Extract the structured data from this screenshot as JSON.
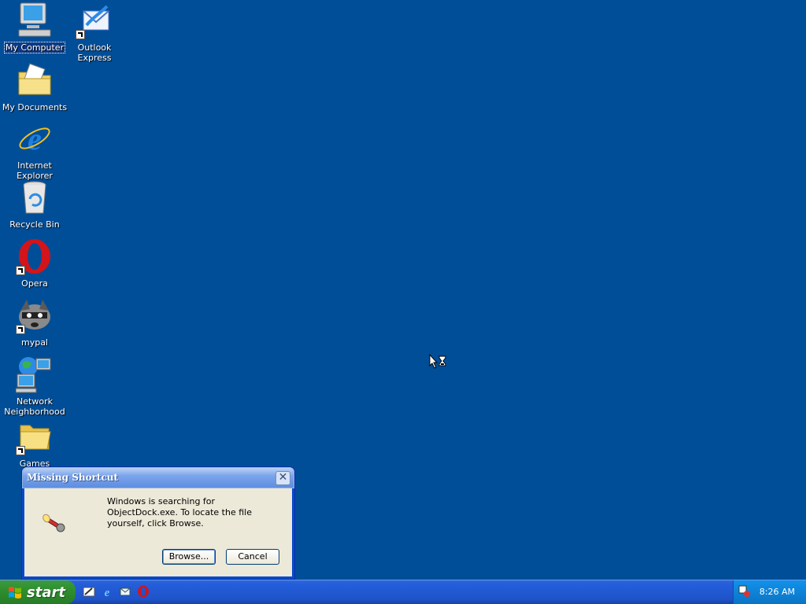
{
  "desktop": {
    "icons": [
      {
        "label": "My Computer",
        "icon": "my-computer-icon"
      },
      {
        "label": "Outlook Express",
        "icon": "outlook-express-icon"
      },
      {
        "label": "My Documents",
        "icon": "my-documents-icon"
      },
      {
        "label": "Internet Explorer",
        "icon": "internet-explorer-icon"
      },
      {
        "label": "Recycle Bin",
        "icon": "recycle-bin-icon"
      },
      {
        "label": "Opera",
        "icon": "opera-icon"
      },
      {
        "label": "mypal",
        "icon": "mypal-icon"
      },
      {
        "label": "Network Neighborhood",
        "icon": "network-icon"
      },
      {
        "label": "Games",
        "icon": "folder-icon"
      }
    ]
  },
  "dialog": {
    "title": "Missing Shortcut",
    "message": "Windows is searching for ObjectDock.exe. To locate the file yourself, click Browse.",
    "browse_label": "Browse...",
    "cancel_label": "Cancel"
  },
  "taskbar": {
    "start_label": "start",
    "quick_launch": [
      "show-desktop-icon",
      "internet-explorer-icon",
      "outlook-express-icon",
      "opera-icon"
    ],
    "clock": "8:26 AM"
  },
  "colors": {
    "desktop_bg": "#004e98",
    "taskbar": "#245edb",
    "start": "#2f8f2f"
  }
}
